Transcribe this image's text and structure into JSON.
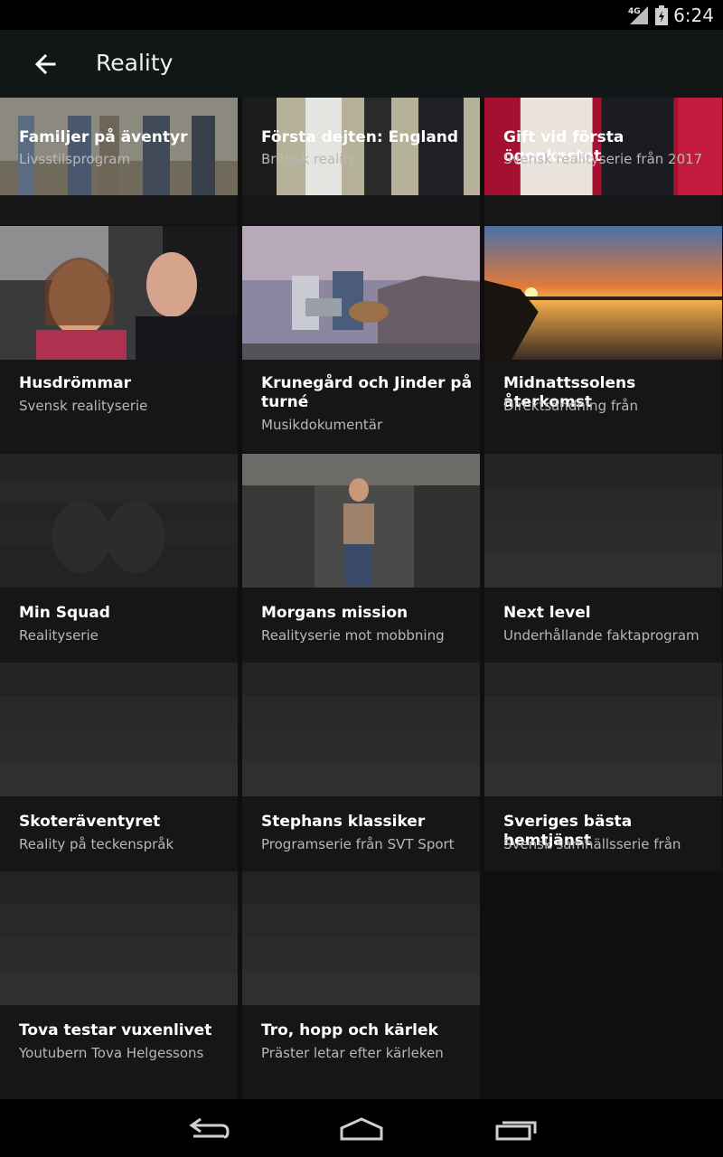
{
  "status": {
    "network": "4G",
    "time": "6:24"
  },
  "appbar": {
    "title": "Reality"
  },
  "cards": [
    {
      "title": "Familjer på äventyr",
      "subtitle": "Livsstilsprogram"
    },
    {
      "title": "Första dejten: England",
      "subtitle": "Brittisk reality"
    },
    {
      "title": "Gift vid första ögonkastet",
      "subtitle": "Svensk realityserie från 2017"
    },
    {
      "title": "Husdrömmar",
      "subtitle": "Svensk realityserie"
    },
    {
      "title": "Krunegård och Jinder på turné",
      "subtitle": "Musikdokumentär"
    },
    {
      "title": "Midnattssolens återkomst",
      "subtitle": "Direktsändning från"
    },
    {
      "title": "Min Squad",
      "subtitle": "Realityserie"
    },
    {
      "title": "Morgans mission",
      "subtitle": "Realityserie mot mobbning"
    },
    {
      "title": "Next level",
      "subtitle": "Underhållande faktaprogram"
    },
    {
      "title": "Skoteräventyret",
      "subtitle": "Reality på teckenspråk"
    },
    {
      "title": "Stephans klassiker",
      "subtitle": "Programserie från SVT Sport"
    },
    {
      "title": "Sveriges bästa hemtjänst",
      "subtitle": "Svensk samhällsserie från"
    },
    {
      "title": "Tova testar vuxenlivet",
      "subtitle": "Youtubern Tova Helgessons"
    },
    {
      "title": "Tro, hopp och kärlek",
      "subtitle": "Präster letar efter kärleken"
    }
  ]
}
